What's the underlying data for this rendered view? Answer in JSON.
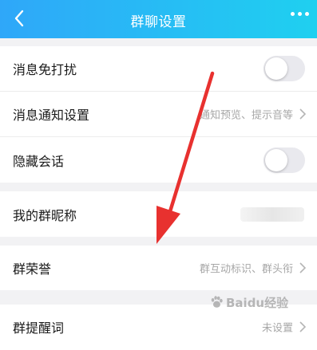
{
  "header": {
    "title": "群聊设置"
  },
  "rows": [
    {
      "label": "消息免打扰",
      "toggle": false
    },
    {
      "label": "消息通知设置",
      "value": "通知预览、提示音等"
    },
    {
      "label": "隐藏会话",
      "toggle": false
    },
    {
      "label": "我的群昵称"
    },
    {
      "label": "群荣誉",
      "value": "群互动标识、群头衔"
    },
    {
      "label": "群提醒词",
      "value": "未设置"
    }
  ],
  "watermark": {
    "text": "Baidu经验"
  },
  "colors": {
    "header_start": "#2fa7f9",
    "header_end": "#1fd0f0",
    "arrow": "#e8312f"
  }
}
